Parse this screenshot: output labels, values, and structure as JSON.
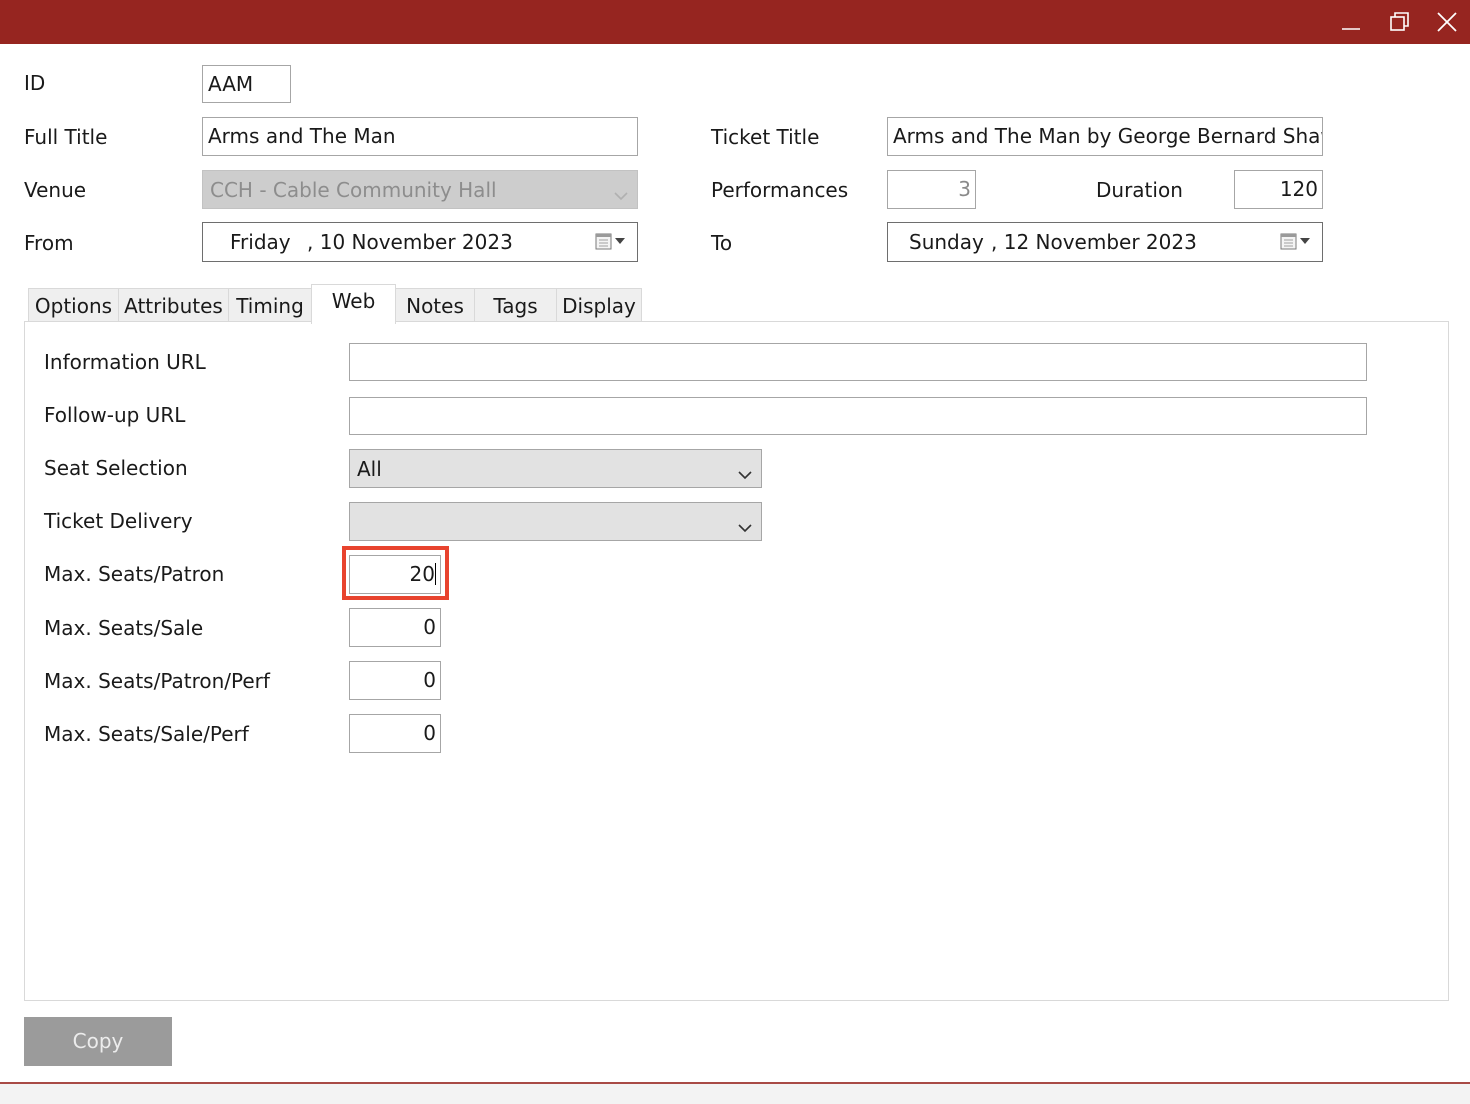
{
  "window": {
    "title": "",
    "controls": [
      "minimize-icon",
      "maximize-icon",
      "close-icon"
    ],
    "accent_color": "#962520"
  },
  "header": {
    "id": {
      "label": "ID",
      "value": "AAM"
    },
    "full_title": {
      "label": "Full Title",
      "value": "Arms and The Man"
    },
    "ticket_title": {
      "label": "Ticket Title",
      "value": "Arms and The Man by George Bernard Shaw"
    },
    "venue": {
      "label": "Venue",
      "value": "CCH - Cable Community Hall"
    },
    "performances": {
      "label": "Performances",
      "value": "3"
    },
    "duration": {
      "label": "Duration",
      "value": "120"
    },
    "from": {
      "label": "From",
      "day": "Friday",
      "date": ", 10 November 2023"
    },
    "to": {
      "label": "To",
      "day": "Sunday",
      "date": ", 12 November 2023"
    }
  },
  "tabs": [
    {
      "label": "Options",
      "active": false
    },
    {
      "label": "Attributes",
      "active": false
    },
    {
      "label": "Timing",
      "active": false
    },
    {
      "label": "Web",
      "active": true
    },
    {
      "label": "Notes",
      "active": false
    },
    {
      "label": "Tags",
      "active": false
    },
    {
      "label": "Display",
      "active": false
    }
  ],
  "web": {
    "information_url": {
      "label": "Information URL",
      "value": ""
    },
    "followup_url": {
      "label": "Follow-up URL",
      "value": ""
    },
    "seat_selection": {
      "label": "Seat Selection",
      "value": "All"
    },
    "ticket_delivery": {
      "label": "Ticket Delivery",
      "value": ""
    },
    "max_seats_patron": {
      "label": "Max. Seats/Patron",
      "value": "20"
    },
    "max_seats_sale": {
      "label": "Max. Seats/Sale",
      "value": "0"
    },
    "max_seats_patron_perf": {
      "label": "Max. Seats/Patron/Perf",
      "value": "0"
    },
    "max_seats_sale_perf": {
      "label": "Max. Seats/Sale/Perf",
      "value": "0"
    }
  },
  "actions": {
    "copy_label": "Copy"
  },
  "highlight_color": "#e8432e"
}
